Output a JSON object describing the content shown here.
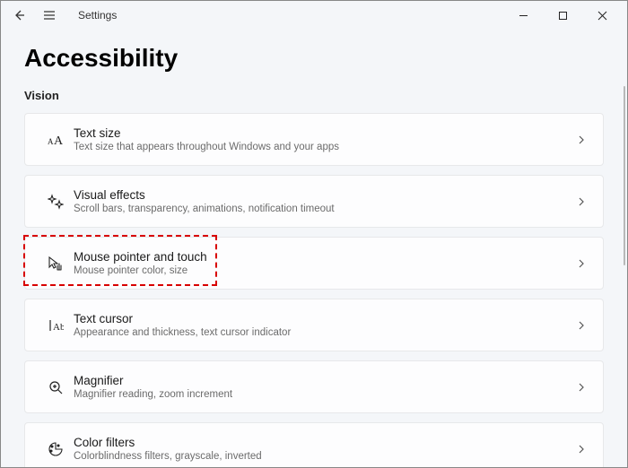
{
  "titlebar": {
    "app_name": "Settings"
  },
  "page": {
    "title": "Accessibility",
    "section": "Vision"
  },
  "items": [
    {
      "title": "Text size",
      "subtitle": "Text size that appears throughout Windows and your apps"
    },
    {
      "title": "Visual effects",
      "subtitle": "Scroll bars, transparency, animations, notification timeout"
    },
    {
      "title": "Mouse pointer and touch",
      "subtitle": "Mouse pointer color, size"
    },
    {
      "title": "Text cursor",
      "subtitle": "Appearance and thickness, text cursor indicator"
    },
    {
      "title": "Magnifier",
      "subtitle": "Magnifier reading, zoom increment"
    },
    {
      "title": "Color filters",
      "subtitle": "Colorblindness filters, grayscale, inverted"
    }
  ]
}
